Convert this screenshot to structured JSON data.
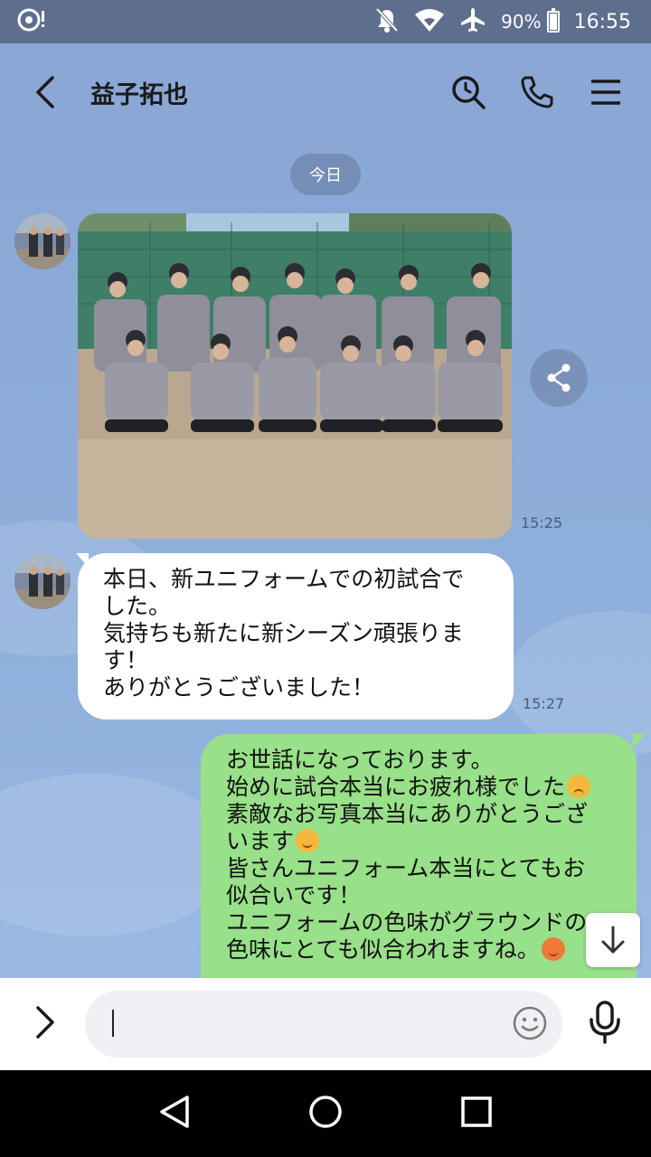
{
  "status_bar": {
    "battery": "90%",
    "time": "16:55"
  },
  "header": {
    "title": "益子拓也"
  },
  "chat": {
    "date": "今日",
    "messages": [
      {
        "type": "image",
        "from": "other",
        "time": "15:25"
      },
      {
        "type": "text",
        "from": "other",
        "time": "15:27",
        "lines": [
          "本日、新ユニフォームでの初試合で",
          "した。",
          "気持ちも新たに新シーズン頑張りま",
          "す！",
          "ありがとうございました！"
        ]
      },
      {
        "type": "text",
        "from": "me",
        "lines": [
          "お世話になっております。",
          "始めに試合本当にお疲れ様でした",
          "素敵なお写真本当にありがとうござ",
          "います",
          "皆さんユニフォーム本当にとてもお",
          "似合いです！",
          "ユニフォームの色味がグラウンドの",
          "色味にとても似合われますね。"
        ]
      }
    ]
  },
  "input": {
    "placeholder": ""
  }
}
